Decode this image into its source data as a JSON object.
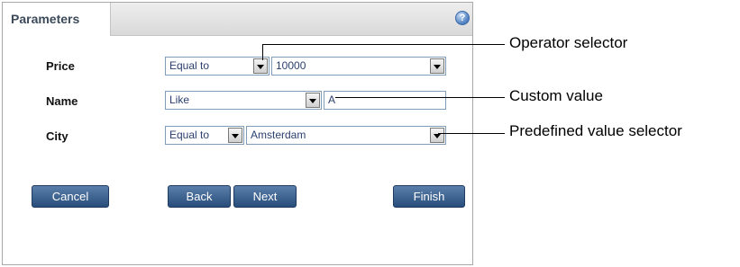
{
  "panel": {
    "tab_title": "Parameters",
    "help_icon": "question-circle-icon"
  },
  "rows": [
    {
      "label": "Price",
      "operator": "Equal to",
      "value": "10000"
    },
    {
      "label": "Name",
      "operator": "Like",
      "value": "A"
    },
    {
      "label": "City",
      "operator": "Equal to",
      "value": "Amsterdam"
    }
  ],
  "buttons": {
    "cancel": "Cancel",
    "back": "Back",
    "next": "Next",
    "finish": "Finish"
  },
  "callouts": {
    "operator": "Operator selector",
    "custom": "Custom value",
    "predefined": "Predefined value selector"
  },
  "colors": {
    "button": "#284d7b",
    "field_border": "#7f9db9"
  }
}
